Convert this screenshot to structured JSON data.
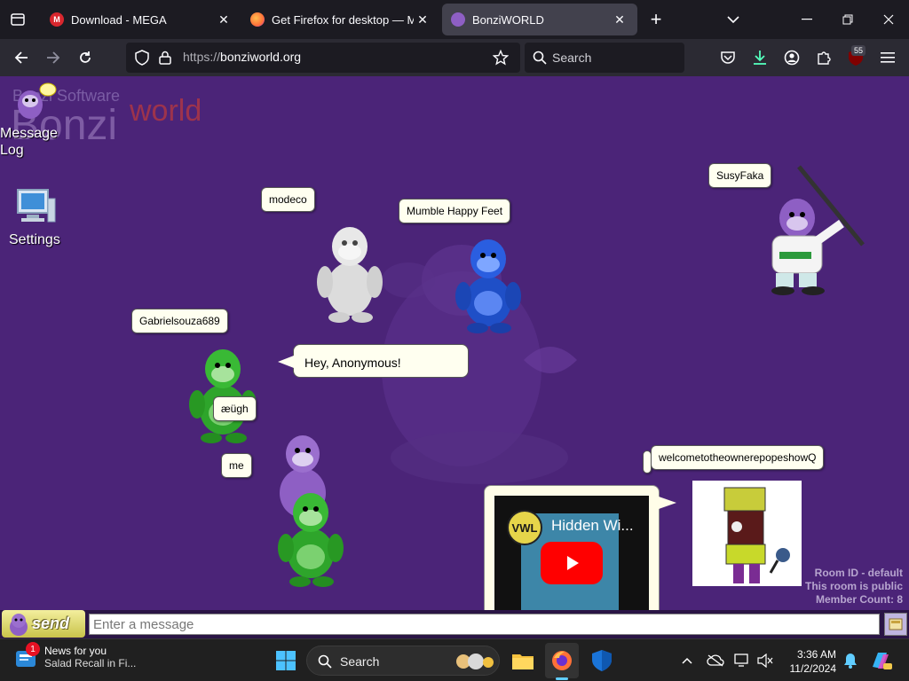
{
  "browser": {
    "tabs": [
      {
        "title": "Download - MEGA",
        "favicon": "mega-icon",
        "favicon_color": "#d9272e",
        "active": false
      },
      {
        "title": "Get Firefox for desktop — Mozilla",
        "favicon": "firefox-icon",
        "favicon_color": "#ff7139",
        "active": false
      },
      {
        "title": "BonziWORLD",
        "favicon": "bonzi-icon",
        "favicon_color": "#8e5fc4",
        "active": true
      }
    ],
    "url_scheme": "https://",
    "url_host": "bonziworld.org",
    "search_placeholder": "Search",
    "extension_badge": "55"
  },
  "page": {
    "background_color": "#4b2478",
    "logo": {
      "sub": "Bonzi Software",
      "main": "Bonzi",
      "accent": "world"
    },
    "desktop_icons": [
      {
        "label_line1": "Message",
        "label_line2": "Log",
        "icon": "message-log-icon"
      },
      {
        "label": "Settings",
        "icon": "settings-icon"
      }
    ],
    "users": [
      {
        "name": "modeco",
        "color": "white"
      },
      {
        "name": "Mumble Happy Feet",
        "color": "blue"
      },
      {
        "name": "SusyFaka",
        "color": "purple"
      },
      {
        "name": "Gabrielsouza689",
        "color": "green"
      },
      {
        "name": "æügh",
        "color": "green"
      },
      {
        "name": "me",
        "color": "purple"
      },
      {
        "name": "welcometotheownerepopeshowQ",
        "color": "custom"
      }
    ],
    "speech": {
      "text": "Hey, Anonymous!"
    },
    "video": {
      "title": "Hidden Wi...",
      "channel_badge": "VWL",
      "thumb_caption": "Hidden Wi..."
    },
    "room": {
      "id_line": "Room ID - default",
      "public_line": "This room is public",
      "count_line": "Member Count: 8"
    }
  },
  "chat": {
    "send_label": "send",
    "input_placeholder": "Enter a message"
  },
  "taskbar": {
    "news_title": "News for you",
    "news_sub": "Salad Recall in Fi...",
    "news_badge": "1",
    "search_label": "Search",
    "time": "3:36 AM",
    "date": "11/2/2024"
  }
}
